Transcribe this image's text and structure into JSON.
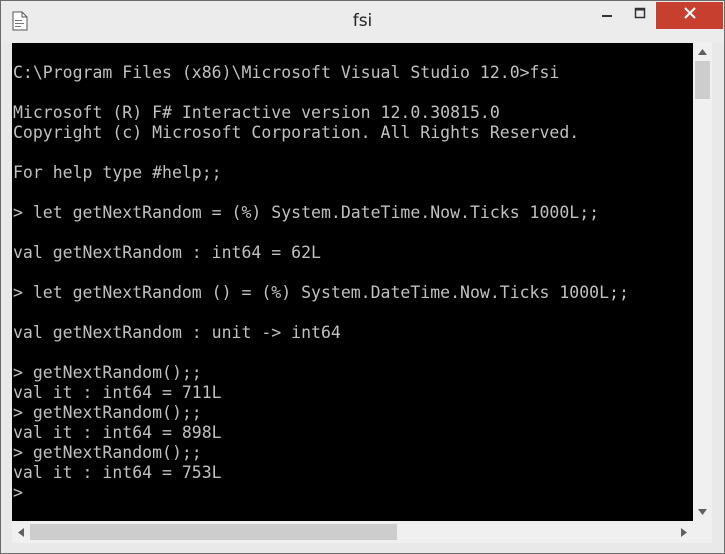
{
  "window": {
    "title": "fsi",
    "icon": "document-icon"
  },
  "title_buttons": {
    "minimize_icon": "minimize-icon",
    "maximize_icon": "maximize-icon",
    "close_icon": "close-icon",
    "close_color": "#c7402f"
  },
  "console": {
    "lines": [
      "C:\\Program Files (x86)\\Microsoft Visual Studio 12.0>fsi",
      "",
      "Microsoft (R) F# Interactive version 12.0.30815.0",
      "Copyright (c) Microsoft Corporation. All Rights Reserved.",
      "",
      "For help type #help;;",
      "",
      "> let getNextRandom = (%) System.DateTime.Now.Ticks 1000L;;",
      "",
      "val getNextRandom : int64 = 62L",
      "",
      "> let getNextRandom () = (%) System.DateTime.Now.Ticks 1000L;;",
      "",
      "val getNextRandom : unit -> int64",
      "",
      "> getNextRandom();;",
      "val it : int64 = 711L",
      "> getNextRandom();;",
      "val it : int64 = 898L",
      "> getNextRandom();;",
      "val it : int64 = 753L",
      ">"
    ],
    "background": "#000000",
    "foreground": "#c0c0c0"
  }
}
